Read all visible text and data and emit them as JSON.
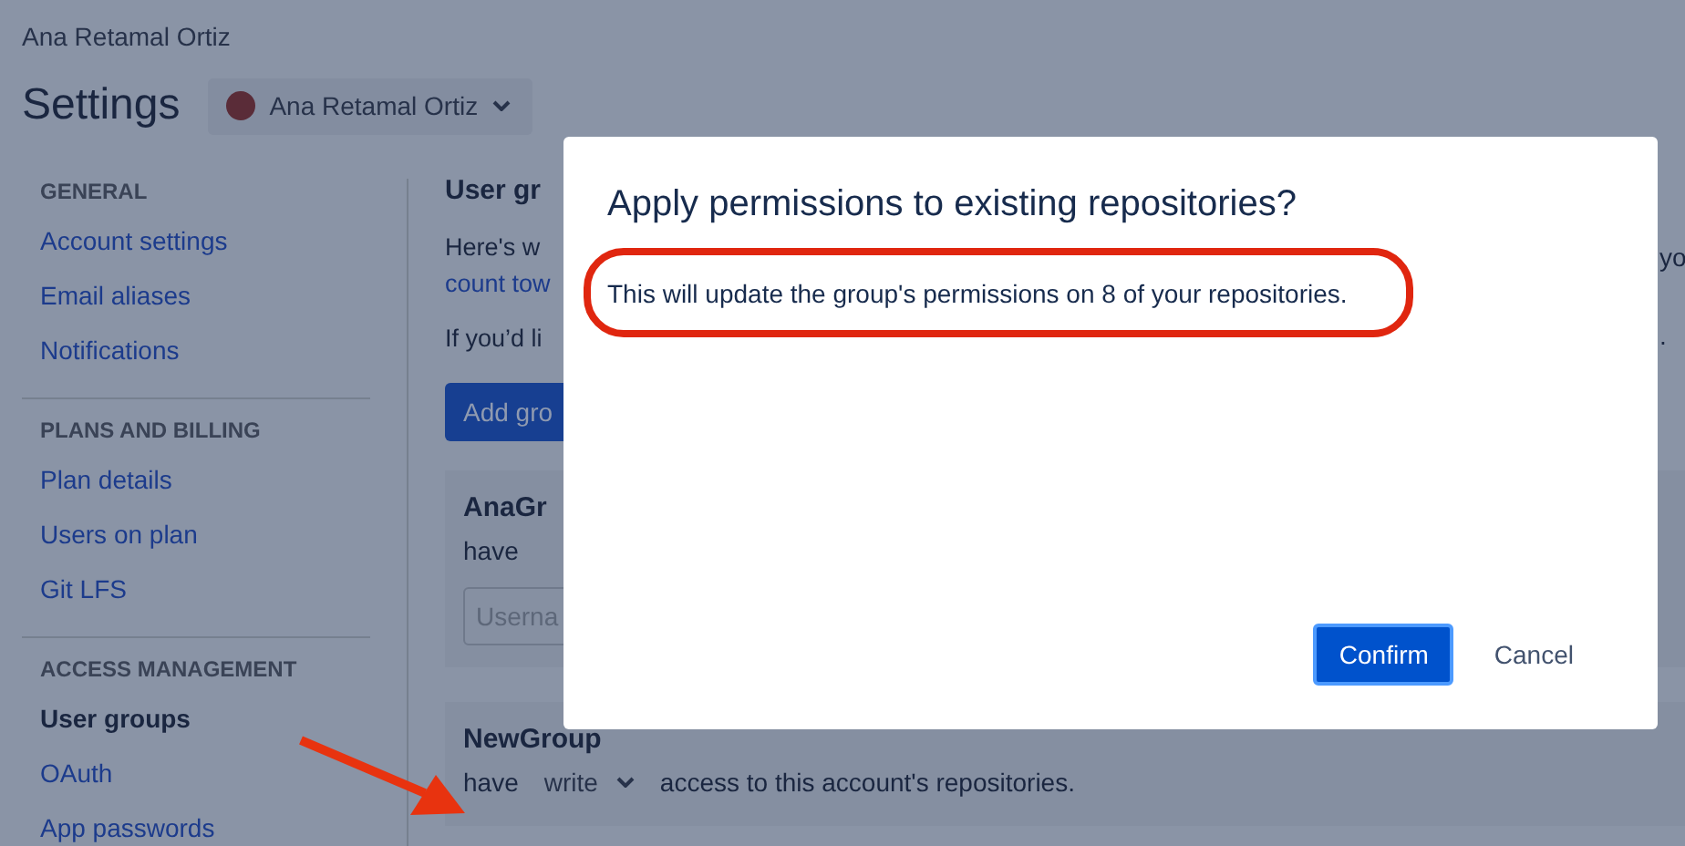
{
  "account_name": "Ana Retamal Ortiz",
  "page_title": "Settings",
  "account_switcher": {
    "label": "Ana Retamal Ortiz"
  },
  "sidebar": {
    "sections": [
      {
        "heading": "GENERAL",
        "items": [
          {
            "label": "Account settings",
            "selected": false
          },
          {
            "label": "Email aliases",
            "selected": false
          },
          {
            "label": "Notifications",
            "selected": false
          }
        ]
      },
      {
        "heading": "PLANS AND BILLING",
        "items": [
          {
            "label": "Plan details",
            "selected": false
          },
          {
            "label": "Users on plan",
            "selected": false
          },
          {
            "label": "Git LFS",
            "selected": false
          }
        ]
      },
      {
        "heading": "ACCESS MANAGEMENT",
        "items": [
          {
            "label": "User groups",
            "selected": true
          },
          {
            "label": "OAuth",
            "selected": false
          },
          {
            "label": "App passwords",
            "selected": false
          }
        ]
      }
    ]
  },
  "main": {
    "heading": "User gr",
    "intro": "Here's w",
    "intro_link": "count tow",
    "intro_end": "yo",
    "note": "If you’d li",
    "note_end": ".",
    "add_button": "Add gro",
    "groups": [
      {
        "name": "AnaGr",
        "have_label": "have",
        "member_placeholder": "Userna"
      },
      {
        "name": "NewGroup",
        "have_label": "have",
        "permission": "write",
        "access_text": "access to this account's repositories."
      }
    ]
  },
  "dialog": {
    "title": "Apply permissions to existing repositories?",
    "message": "This will update the group's permissions on 8 of your repositories.",
    "buttons": [
      {
        "label": "Confirm",
        "kind": "primary"
      },
      {
        "label": "Cancel",
        "kind": "subtle"
      }
    ]
  }
}
